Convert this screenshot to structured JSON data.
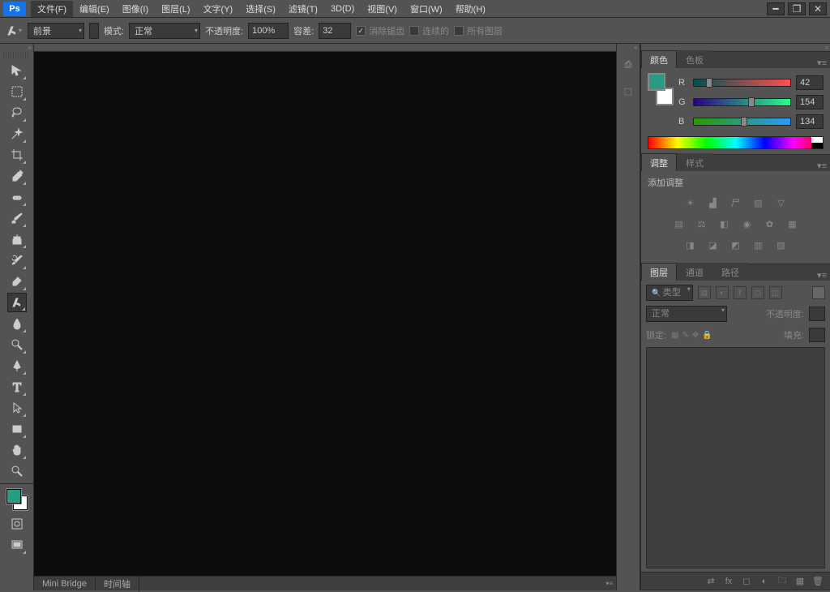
{
  "menu": {
    "items": [
      "文件(F)",
      "编辑(E)",
      "图像(I)",
      "图层(L)",
      "文字(Y)",
      "选择(S)",
      "滤镜(T)",
      "3D(D)",
      "视图(V)",
      "窗口(W)",
      "帮助(H)"
    ]
  },
  "options": {
    "fill_dropdown": "前景",
    "mode_label": "模式:",
    "mode_value": "正常",
    "opacity_label": "不透明度:",
    "opacity_value": "100%",
    "tolerance_label": "容差:",
    "tolerance_value": "32",
    "antialias_label": "消除锯齿",
    "contiguous_label": "连续的",
    "all_layers_label": "所有图层"
  },
  "bottom_tabs": {
    "minibridge": "Mini Bridge",
    "timeline": "时间轴"
  },
  "panels": {
    "color_tab": "颜色",
    "swatch_tab": "色板",
    "rgb": {
      "r_label": "R",
      "r_val": "42",
      "g_label": "G",
      "g_val": "154",
      "b_label": "B",
      "b_val": "134"
    },
    "adjust_tab": "调整",
    "styles_tab": "样式",
    "add_adjust": "添加调整",
    "layers_tab": "图层",
    "channels_tab": "通道",
    "paths_tab": "路径",
    "kind_label": "类型",
    "blend_mode": "正常",
    "opacity_label": "不透明度:",
    "lock_label": "锁定:",
    "fill_label": "填充:"
  },
  "colors": {
    "fg": "#2a9a86",
    "bg": "#ffffff"
  },
  "tools": [
    "move-tool",
    "marquee-tool",
    "lasso-tool",
    "magic-wand-tool",
    "crop-tool",
    "eyedropper-tool",
    "healing-brush-tool",
    "brush-tool",
    "clone-stamp-tool",
    "history-brush-tool",
    "eraser-tool",
    "paint-bucket-tool",
    "blur-tool",
    "dodge-tool",
    "pen-tool",
    "type-tool",
    "path-select-tool",
    "rectangle-tool",
    "hand-tool",
    "zoom-tool"
  ]
}
